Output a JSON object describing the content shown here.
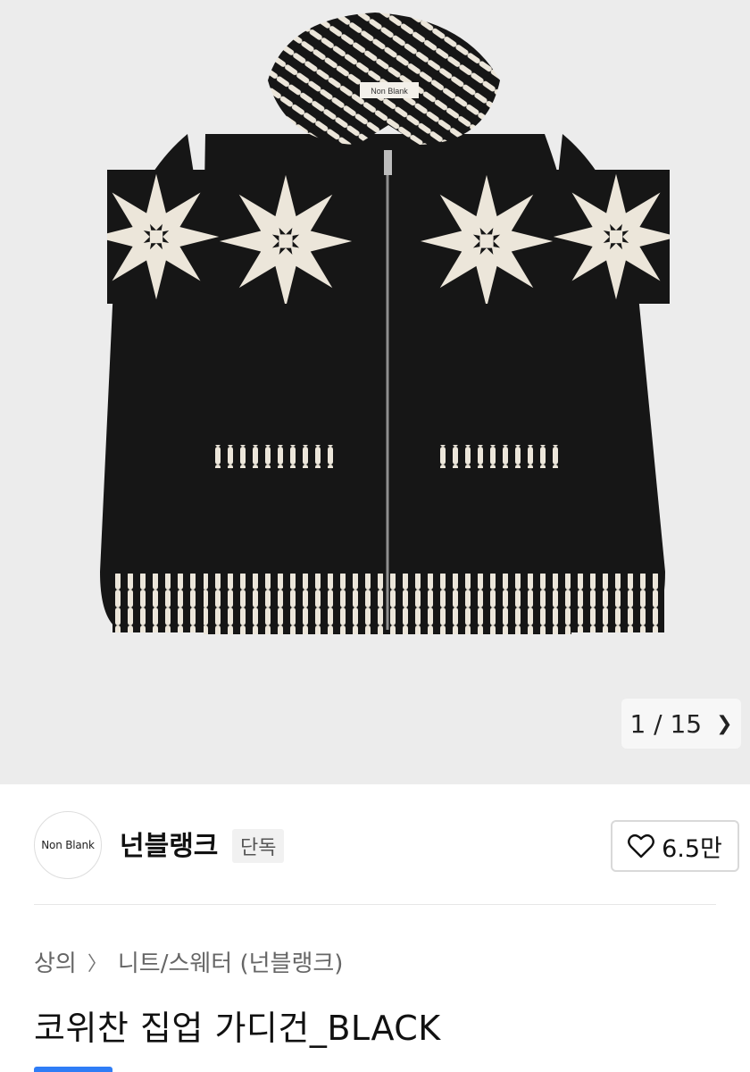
{
  "gallery": {
    "current": "1",
    "separator": "/",
    "total": "15",
    "counter_text": "1 / 15",
    "next_icon": "chevron-right-icon",
    "collar_label": "Non Blank"
  },
  "brand": {
    "logo_text": "Non Blank",
    "name": "넌블랭크",
    "badge": "단독",
    "likes": "6.5만",
    "like_icon": "heart-outline-icon"
  },
  "breadcrumb": {
    "items": [
      "상의",
      "니트/스웨터 (넌블랭크)"
    ],
    "separator_icon": "chevron-right-icon"
  },
  "product": {
    "title": "코위찬 집업 가디건_BLACK"
  },
  "colors": {
    "image_bg": "#ececec",
    "knit_black": "#161616",
    "knit_cream": "#ece6da",
    "accent_blue": "#2f7df6"
  }
}
